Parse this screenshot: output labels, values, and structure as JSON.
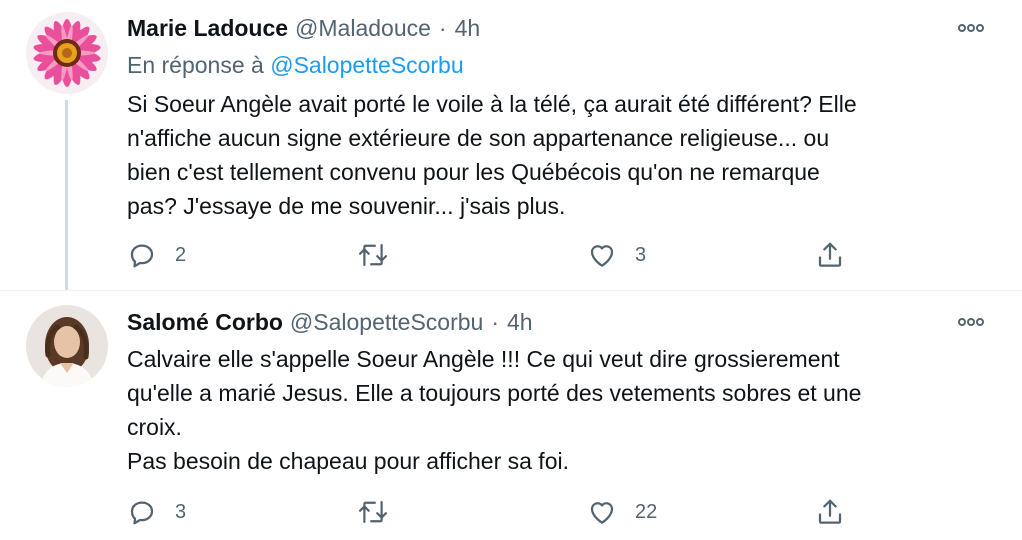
{
  "tweets": [
    {
      "name": "Marie Ladouce",
      "handle": "@Maladouce",
      "separator": "·",
      "time": "4h",
      "reply_prefix": "En réponse à",
      "reply_to": "@SalopetteScorbu",
      "lines": [
        "Si Soeur Angèle avait porté le voile à la télé, ça aurait été différent? Elle",
        "n'affiche aucun signe extérieure de son appartenance religieuse... ou",
        "bien c'est tellement convenu pour les Québécois qu'on ne remarque",
        "pas? J'essaye de me souvenir... j'sais plus."
      ],
      "reply_count": "2",
      "retweet_count": "",
      "like_count": "3"
    },
    {
      "name": "Salomé Corbo",
      "handle": "@SalopetteScorbu",
      "separator": "·",
      "time": "4h",
      "lines": [
        "Calvaire elle s'appelle Soeur Angèle !!! Ce qui veut dire grossierement",
        "qu'elle a marié Jesus. Elle a toujours porté des vetements sobres et une",
        "croix.",
        "Pas besoin de chapeau pour afficher sa foi."
      ],
      "reply_count": "3",
      "retweet_count": "",
      "like_count": "22"
    }
  ],
  "icons": {
    "reply": "reply-icon",
    "retweet": "retweet-icon",
    "like": "heart-icon",
    "share": "share-icon",
    "more": "more-icon"
  },
  "colors": {
    "text": "#0f1419",
    "secondary": "#536471",
    "link": "#1d9bf0",
    "thread_line": "#cfd9de"
  }
}
